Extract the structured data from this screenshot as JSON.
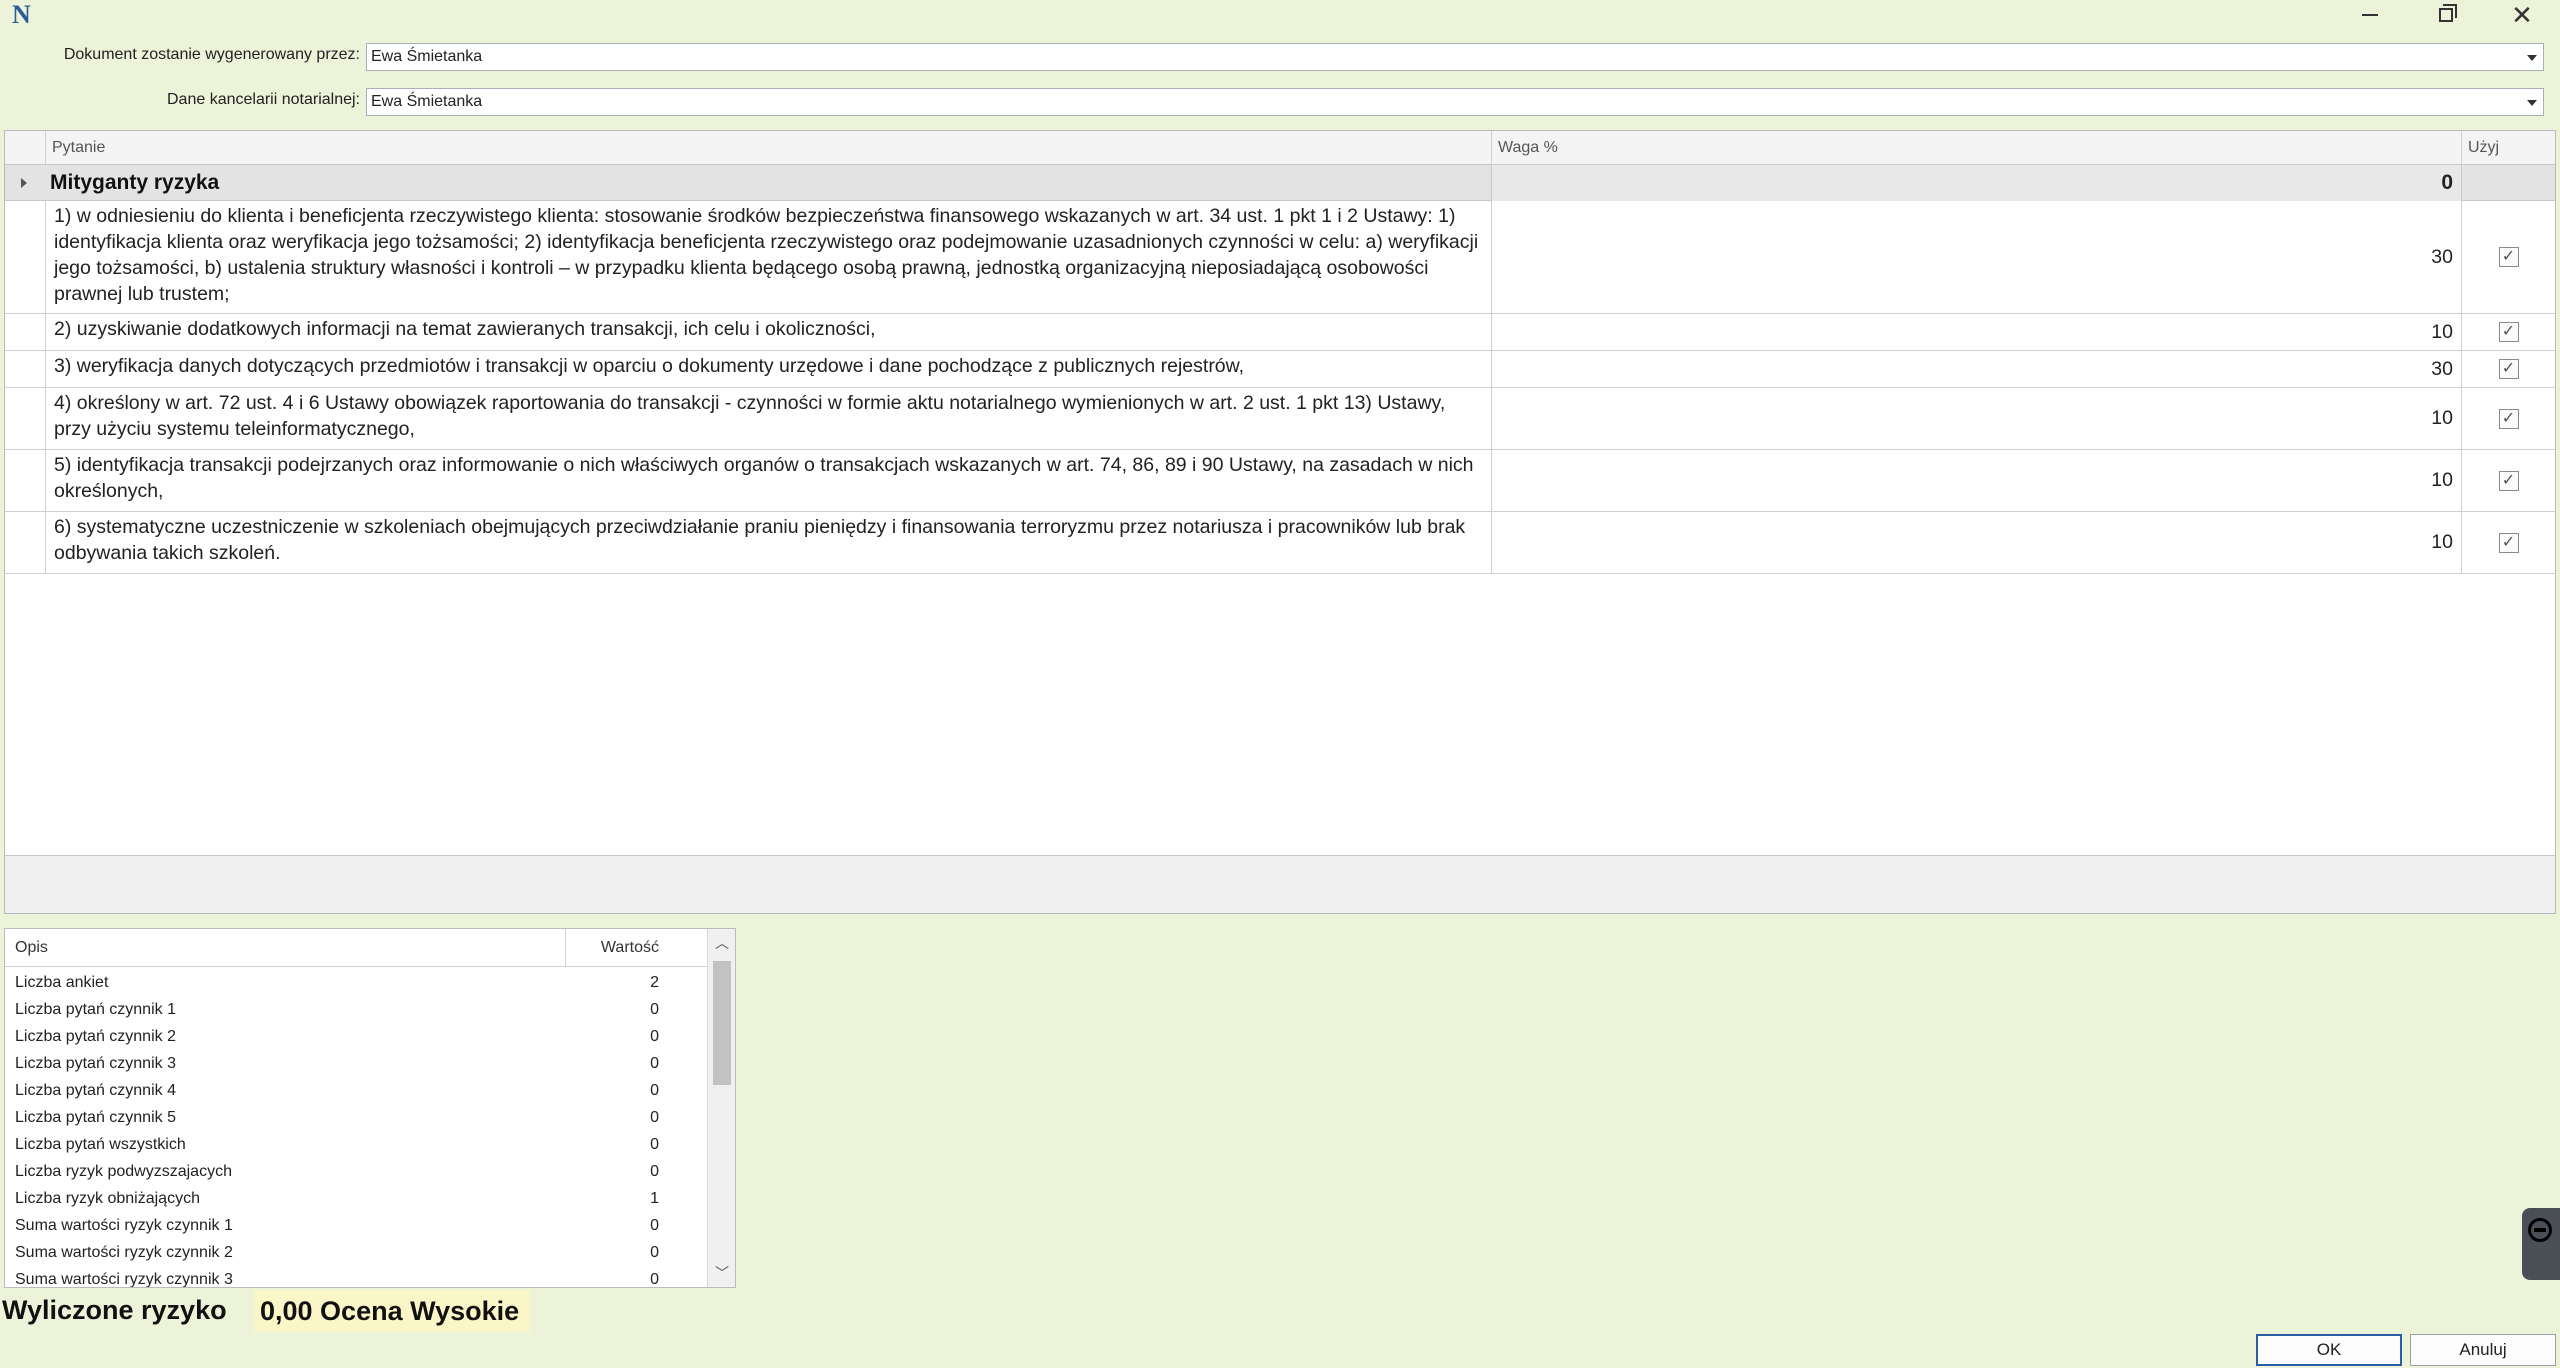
{
  "window": {
    "logo": "N",
    "close_glyph": "✕"
  },
  "form": {
    "generated_by_label": "Dokument zostanie wygenerowany przez:",
    "generated_by_value": "Ewa Śmietanka",
    "office_label": "Dane kancelarii notarialnej:",
    "office_value": "Ewa Śmietanka"
  },
  "grid": {
    "columns": {
      "question": "Pytanie",
      "weight": "Waga %",
      "use": "Użyj"
    },
    "group": {
      "title": "Mityganty ryzyka",
      "weight": "0"
    },
    "rows": [
      {
        "text": "1) w odniesieniu do klienta i beneficjenta rzeczywistego klienta: stosowanie środków bezpieczeństwa finansowego wskazanych w art. 34 ust. 1 pkt 1 i 2 Ustawy: 1) identyfikacja klienta oraz weryfikacja jego tożsamości;              2) identyfikacja beneficjenta rzeczywistego oraz podejmowanie uzasadnionych czynności w celu: a) weryfikacji jego tożsamości, b) ustalenia struktury własności i kontroli – w przypadku klienta będącego osobą prawną, jednostką organizacyjną nieposiadającą osobowości prawnej lub trustem;",
        "weight": "30",
        "checked": true
      },
      {
        "text": "2) uzyskiwanie dodatkowych informacji na temat zawieranych transakcji, ich celu i okoliczności,",
        "weight": "10",
        "checked": true
      },
      {
        "text": "3) weryfikacja danych dotyczących przedmiotów i transakcji w oparciu o dokumenty urzędowe i dane pochodzące z publicznych rejestrów,",
        "weight": "30",
        "checked": true
      },
      {
        "text": "4) określony w art. 72 ust. 4 i 6 Ustawy obowiązek raportowania do transakcji - czynności w formie aktu notarialnego wymienionych w art. 2 ust. 1 pkt 13) Ustawy, przy użyciu systemu teleinformatycznego,",
        "weight": "10",
        "checked": true
      },
      {
        "text": "5) identyfikacja transakcji podejrzanych oraz informowanie o nich właściwych organów o transakcjach wskazanych w art. 74, 86, 89 i 90 Ustawy, na zasadach w nich określonych,",
        "weight": "10",
        "checked": true
      },
      {
        "text": "6) systematyczne uczestniczenie w szkoleniach obejmujących przeciwdziałanie praniu pieniędzy i finansowania terroryzmu przez notariusza i pracowników lub brak odbywania takich szkoleń.",
        "weight": "10",
        "checked": true
      }
    ],
    "check_glyph": "✓"
  },
  "summary": {
    "col_desc": "Opis",
    "col_value": "Wartość",
    "rows": [
      {
        "name": "Liczba ankiet",
        "value": "2"
      },
      {
        "name": "Liczba pytań czynnik 1",
        "value": "0"
      },
      {
        "name": "Liczba pytań czynnik 2",
        "value": "0"
      },
      {
        "name": "Liczba pytań czynnik 3",
        "value": "0"
      },
      {
        "name": "Liczba pytań czynnik 4",
        "value": "0"
      },
      {
        "name": "Liczba pytań czynnik 5",
        "value": "0"
      },
      {
        "name": "Liczba pytań wszystkich",
        "value": "0"
      },
      {
        "name": "Liczba ryzyk podwyzszajacych",
        "value": "0"
      },
      {
        "name": "Liczba ryzyk obniżających",
        "value": "1"
      },
      {
        "name": "Suma wartości ryzyk czynnik 1",
        "value": "0"
      },
      {
        "name": "Suma wartości ryzyk czynnik 2",
        "value": "0"
      },
      {
        "name": "Suma wartości ryzyk czynnik 3",
        "value": "0"
      }
    ],
    "scroll_up": "︿",
    "scroll_down": "﹀"
  },
  "result": {
    "label": "Wyliczone ryzyko",
    "value": "0,00 Ocena Wysokie"
  },
  "buttons": {
    "ok": "OK",
    "cancel": "Anuluj"
  }
}
